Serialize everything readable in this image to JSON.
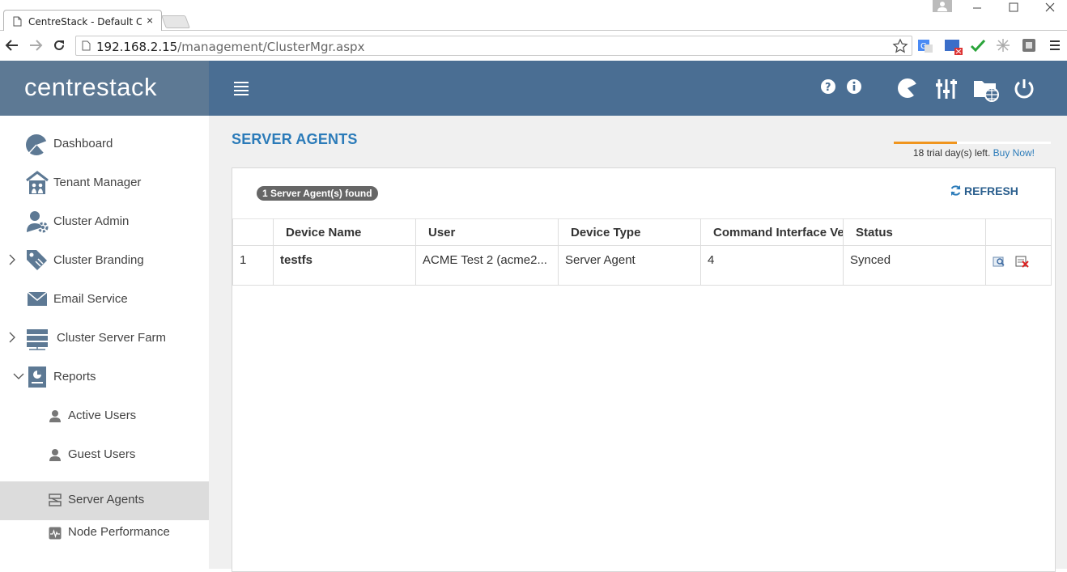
{
  "browser": {
    "tab_title": "CentreStack - Default Clus",
    "tab_close": "×",
    "url_host": "192.168.2.15",
    "url_path": "/management/ClusterMgr.aspx"
  },
  "app": {
    "brand": "centrestack"
  },
  "sidebar": {
    "items": [
      {
        "label": "Dashboard",
        "icon": "dashboard-icon"
      },
      {
        "label": "Tenant Manager",
        "icon": "tenant-icon"
      },
      {
        "label": "Cluster Admin",
        "icon": "cluster-admin-icon"
      },
      {
        "label": "Cluster Branding",
        "icon": "branding-icon"
      },
      {
        "label": "Email Service",
        "icon": "email-icon"
      },
      {
        "label": "Cluster Server Farm",
        "icon": "server-farm-icon"
      },
      {
        "label": "Reports",
        "icon": "reports-icon"
      },
      {
        "label": "Active Users",
        "icon": "user-icon"
      },
      {
        "label": "Guest Users",
        "icon": "user-icon"
      },
      {
        "label": "Server Agents",
        "icon": "server-agent-icon"
      },
      {
        "label": "Node Performance",
        "icon": "performance-icon"
      }
    ],
    "active": "Server Agents"
  },
  "main": {
    "title": "SERVER AGENTS",
    "trial": {
      "text": "18 trial day(s) left.",
      "buy": "Buy Now!",
      "remaining_fraction": 0.4,
      "bar_color": "#f0951e"
    },
    "found_badge": "1 Server Agent(s) found",
    "refresh_label": "REFRESH",
    "table": {
      "columns": [
        "",
        "Device Name",
        "User",
        "Device Type",
        "Command Interface Ver",
        "Status",
        ""
      ],
      "rows": [
        {
          "index": "1",
          "device_name": "testfs",
          "user": "ACME Test 2 (acme2...",
          "device_type": "Server Agent",
          "cmd_version": "4",
          "status": "Synced"
        }
      ]
    }
  },
  "colors": {
    "header": "#4a6e93",
    "brand_bg": "#5d7994",
    "accent": "#2b7bb9"
  }
}
